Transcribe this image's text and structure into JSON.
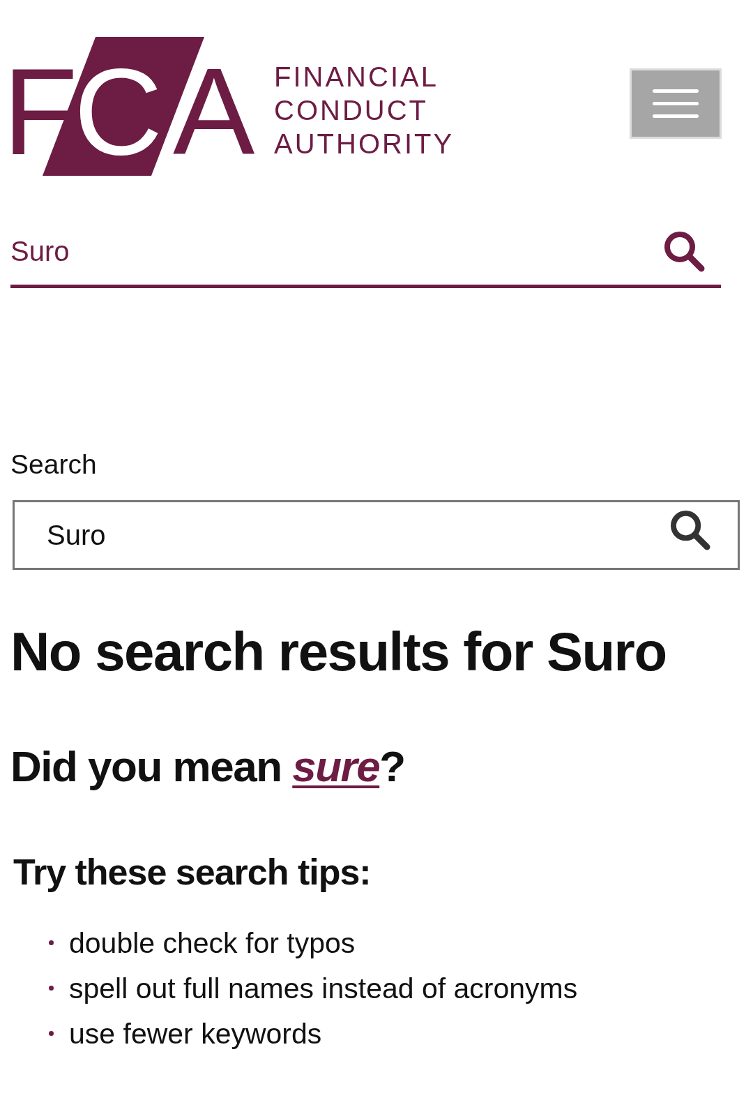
{
  "header": {
    "logo": {
      "letters": "FCA",
      "tagline": "FINANCIAL CONDUCT AUTHORITY"
    }
  },
  "site_search": {
    "value": "Suro"
  },
  "search_form": {
    "label": "Search",
    "value": "Suro"
  },
  "results": {
    "heading": "No search results for Suro",
    "suggestion": {
      "prefix": "Did you mean",
      "link": "sure",
      "suffix": "?"
    },
    "tips_heading": "Try these search tips:",
    "tips": [
      "double check for typos",
      "spell out full names instead of acronyms",
      "use fewer keywords"
    ]
  }
}
